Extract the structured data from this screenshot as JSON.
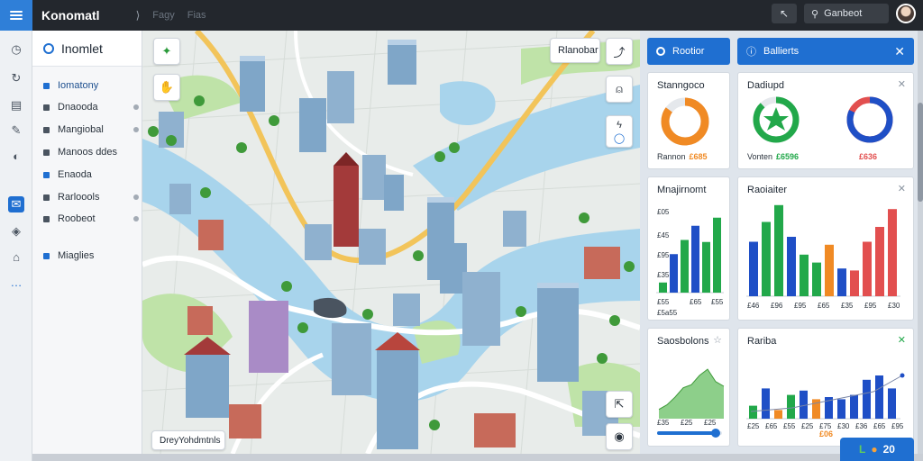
{
  "app": {
    "title": "Konomatl",
    "top_icon": "⟩",
    "top_faint_1": "Fagy",
    "top_faint_2": "Fias"
  },
  "topbar": {
    "search_label": "Ganbeot"
  },
  "sidenav": {
    "header": "Inomlet",
    "items": [
      {
        "label": "Iomatony",
        "active": true
      },
      {
        "label": "Dnaooda"
      },
      {
        "label": "Mangiobal"
      },
      {
        "label": "Manoos ddes"
      },
      {
        "label": "Enaoda"
      },
      {
        "label": "Rarloools"
      },
      {
        "label": "Roobeot"
      },
      {
        "label": "Miaglies"
      }
    ]
  },
  "map": {
    "top_label": "Rlanobar",
    "bottom_label": "DreyYohdmtnls",
    "colors": {
      "water": "#a8d4ec",
      "land": "#e8ecea",
      "park": "#bfe3a8",
      "road_main": "#f2c45a",
      "road": "#ffffff"
    }
  },
  "panel": {
    "btn_left": "Rootior",
    "btn_right": "Ballierts",
    "cards": {
      "donut1": {
        "title": "Stanngoco",
        "foot_label": "Rannon",
        "foot_value": "£685",
        "color": "#f08a24"
      },
      "donut2": {
        "title": "Dadiupd",
        "foot_label": "Vonten",
        "foot_value": "£6596",
        "color": "#22a84a"
      },
      "donut3": {
        "foot_value": "£636",
        "color": "#1f4fc6",
        "accent": "#e24f4f"
      },
      "bars1": {
        "title": "Mnajirnomt",
        "ticks": [
          "£05",
          "£45",
          "£95",
          "£35"
        ],
        "xticks": [
          "£55",
          "£65",
          "£55"
        ],
        "foot": "£5a55"
      },
      "bars2": {
        "title": "Raoiaiter",
        "xticks": [
          "£46",
          "£96",
          "£95",
          "£65",
          "£35",
          "£95",
          "£30"
        ]
      },
      "area": {
        "title": "Saosbolons",
        "xticks": [
          "£35",
          "£25",
          "£25"
        ]
      },
      "bars3": {
        "title": "Rariba",
        "xticks": [
          "£25",
          "£65",
          "£55",
          "£25",
          "£75",
          "£30",
          "£36",
          "£65",
          "£95"
        ],
        "foot": "£06"
      }
    }
  },
  "badge": {
    "a": "L",
    "b": "20"
  },
  "chart_data": [
    {
      "type": "pie",
      "title": "Stanngoco",
      "values": [
        85,
        15
      ]
    },
    {
      "type": "pie",
      "title": "Dadiupd",
      "values": [
        88,
        12
      ]
    },
    {
      "type": "pie",
      "values": [
        82,
        18
      ]
    },
    {
      "type": "bar",
      "title": "Mnajirnomt",
      "values": [
        10,
        38,
        52,
        66,
        50,
        74
      ]
    },
    {
      "type": "bar",
      "title": "Raoiaiter",
      "values": [
        55,
        75,
        92,
        60,
        42,
        34,
        52,
        28,
        26,
        55,
        70,
        88
      ]
    },
    {
      "type": "area",
      "title": "Saosbolons",
      "values": [
        12,
        18,
        28,
        40,
        44,
        56,
        64,
        48,
        42
      ]
    },
    {
      "type": "bar",
      "title": "Rariba",
      "values": [
        12,
        28,
        8,
        22,
        26,
        18,
        20,
        18,
        22,
        36,
        40,
        28
      ]
    }
  ]
}
